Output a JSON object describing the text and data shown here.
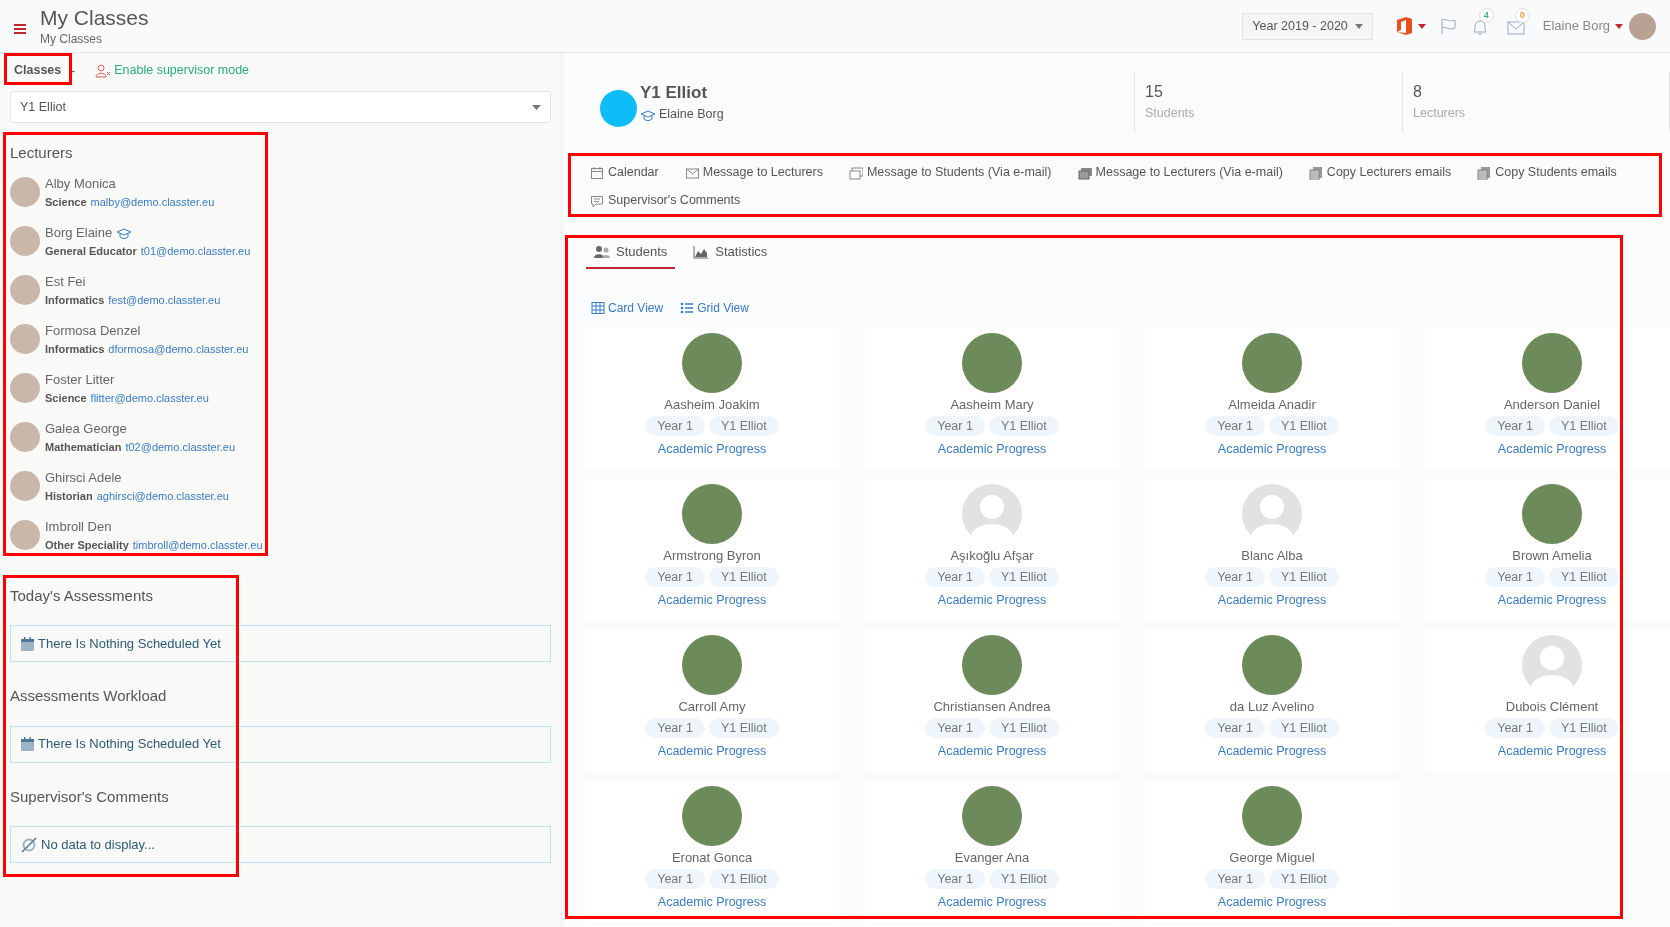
{
  "header": {
    "title": "My Classes",
    "breadcrumb": "My Classes",
    "year_selector": "Year 2019 - 2020",
    "notifications_count": "4",
    "messages_count": "0",
    "user_name": "Elaine Borg"
  },
  "sidebar": {
    "classes_label": "Classes",
    "separator": "-",
    "supervisor_link": "Enable supervisor mode",
    "class_select": "Y1 Elliot",
    "lecturers_title": "Lecturers",
    "lecturers": [
      {
        "name": "Alby Monica",
        "specialty": "Science",
        "email": "malby@demo.classter.eu",
        "educator": false
      },
      {
        "name": "Borg Elaine",
        "specialty": "General Educator",
        "email": "t01@demo.classter.eu",
        "educator": true
      },
      {
        "name": "Est Fei",
        "specialty": "Informatics",
        "email": "fest@demo.classter.eu",
        "educator": false
      },
      {
        "name": "Formosa Denzel",
        "specialty": "Informatics",
        "email": "dformosa@demo.classter.eu",
        "educator": false
      },
      {
        "name": "Foster Litter",
        "specialty": "Science",
        "email": "flitter@demo.classter.eu",
        "educator": false
      },
      {
        "name": "Galea George",
        "specialty": "Mathematician",
        "email": "t02@demo.classter.eu",
        "educator": false
      },
      {
        "name": "Ghirsci Adele",
        "specialty": "Historian",
        "email": "aghirsci@demo.classter.eu",
        "educator": false
      },
      {
        "name": "Imbroll Den",
        "specialty": "Other Speciality",
        "email": "timbroll@demo.classter.eu",
        "educator": false
      }
    ],
    "sections": [
      {
        "title": "Today's Assessments",
        "kind": "calendar",
        "message": "There Is Nothing Scheduled Yet"
      },
      {
        "title": "Assessments Workload",
        "kind": "calendar",
        "message": "There Is Nothing Scheduled Yet"
      },
      {
        "title": "Supervisor's Comments",
        "kind": "empty",
        "message": "No data to display..."
      }
    ]
  },
  "class_info": {
    "name": "Y1 Elliot",
    "teacher": "Elaine Borg",
    "stats": [
      {
        "value": "15",
        "label": "Students"
      },
      {
        "value": "8",
        "label": "Lecturers"
      }
    ]
  },
  "actions": [
    {
      "label": "Calendar",
      "kind": "calendar"
    },
    {
      "label": "Message to Lecturers",
      "kind": "envelope"
    },
    {
      "label": "Message to Students (Via e-mail)",
      "kind": "mail-stack"
    },
    {
      "label": "Message to Lecturers (Via e-mail)",
      "kind": "mail-stack-dark"
    },
    {
      "label": "Copy Lecturers emails",
      "kind": "copy"
    },
    {
      "label": "Copy Students emails",
      "kind": "copy"
    },
    {
      "label": "Supervisor's Comments",
      "kind": "comment"
    }
  ],
  "tabs": [
    {
      "label": "Students",
      "kind": "people",
      "selected": true
    },
    {
      "label": "Statistics",
      "kind": "chart",
      "selected": false
    }
  ],
  "views": [
    {
      "label": "Card View",
      "kind": "table"
    },
    {
      "label": "Grid View",
      "kind": "list"
    }
  ],
  "students": [
    {
      "name": "Aasheim Joakim",
      "year": "Year 1",
      "class": "Y1 Elliot",
      "link": "Academic Progress",
      "kind": "photo"
    },
    {
      "name": "Aasheim Mary",
      "year": "Year 1",
      "class": "Y1 Elliot",
      "link": "Academic Progress",
      "kind": "photo"
    },
    {
      "name": "Almeida Anadir",
      "year": "Year 1",
      "class": "Y1 Elliot",
      "link": "Academic Progress",
      "kind": "photo"
    },
    {
      "name": "Anderson Daniel",
      "year": "Year 1",
      "class": "Y1 Elliot",
      "link": "Academic Progress",
      "kind": "photo"
    },
    {
      "name": "Armstrong Byron",
      "year": "Year 1",
      "class": "Y1 Elliot",
      "link": "Academic Progress",
      "kind": "photo"
    },
    {
      "name": "Aşıkoğlu Afşar",
      "year": "Year 1",
      "class": "Y1 Elliot",
      "link": "Academic Progress",
      "kind": "silhouette"
    },
    {
      "name": "Blanc Alba",
      "year": "Year 1",
      "class": "Y1 Elliot",
      "link": "Academic Progress",
      "kind": "silhouette"
    },
    {
      "name": "Brown Amelia",
      "year": "Year 1",
      "class": "Y1 Elliot",
      "link": "Academic Progress",
      "kind": "photo"
    },
    {
      "name": "Carroll Amy",
      "year": "Year 1",
      "class": "Y1 Elliot",
      "link": "Academic Progress",
      "kind": "photo"
    },
    {
      "name": "Christiansen Andrea",
      "year": "Year 1",
      "class": "Y1 Elliot",
      "link": "Academic Progress",
      "kind": "photo"
    },
    {
      "name": "da Luz Avelino",
      "year": "Year 1",
      "class": "Y1 Elliot",
      "link": "Academic Progress",
      "kind": "photo"
    },
    {
      "name": "Dubois Clément",
      "year": "Year 1",
      "class": "Y1 Elliot",
      "link": "Academic Progress",
      "kind": "silhouette"
    },
    {
      "name": "Eronat Gonca",
      "year": "Year 1",
      "class": "Y1 Elliot",
      "link": "Academic Progress",
      "kind": "photo"
    },
    {
      "name": "Evanger Ana",
      "year": "Year 1",
      "class": "Y1 Elliot",
      "link": "Academic Progress",
      "kind": "photo"
    },
    {
      "name": "George Miguel",
      "year": "Year 1",
      "class": "Y1 Elliot",
      "link": "Academic Progress",
      "kind": "photo"
    }
  ]
}
